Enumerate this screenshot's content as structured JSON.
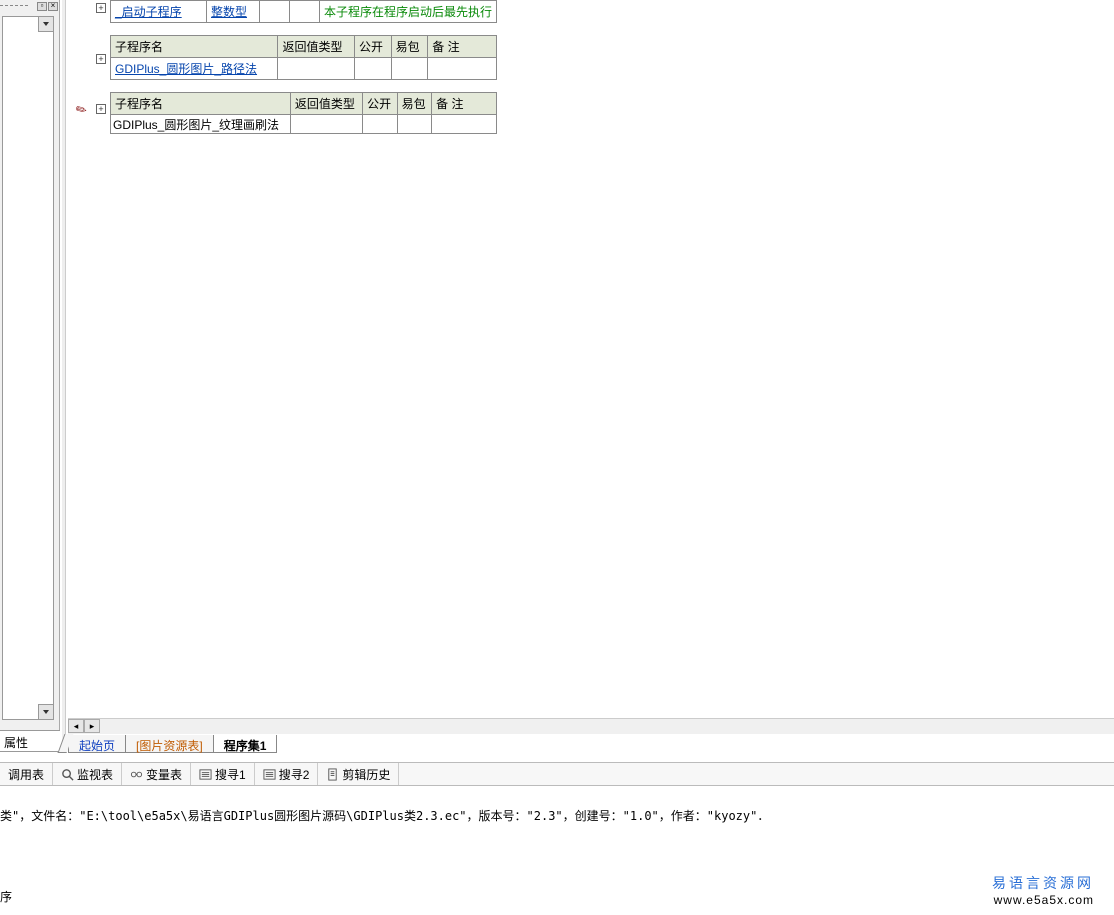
{
  "left_panel": {
    "properties_label": "属性"
  },
  "tables": {
    "row0": {
      "name": "_启动子程序",
      "ret_type": "整数型",
      "public": "",
      "pkg": "",
      "remark": "本子程序在程序启动后最先执行"
    },
    "headers": {
      "name": "子程序名",
      "ret_type": "返回值类型",
      "public": "公开",
      "pkg": "易包",
      "remark": "备 注"
    },
    "row1": {
      "name": "GDIPlus_圆形图片_路径法",
      "ret_type": "",
      "public": "",
      "pkg": "",
      "remark": ""
    },
    "row2": {
      "name": "GDIPlus_圆形图片_纹理画刷法",
      "ret_type": "",
      "public": "",
      "pkg": "",
      "remark": ""
    }
  },
  "code_tabs": {
    "start": "起始页",
    "image_res": "[图片资源表]",
    "program_set": "程序集1"
  },
  "toolbar": {
    "call_table": "调用表",
    "monitor_table": "监视表",
    "variable_table": "变量表",
    "search1": "搜寻1",
    "search2": "搜寻2",
    "clip_history": "剪辑历史"
  },
  "output": {
    "line": "类\"，文件名：\"E:\\tool\\e5a5x\\易语言GDIPlus圆形图片源码\\GDIPlus类2.3.ec\"，版本号：\"2.3\"，创建号：\"1.0\"，作者：\"kyozy\"．",
    "line2": "序"
  },
  "watermark": {
    "cn": "易语言资源网",
    "en": "www.e5a5x.com"
  }
}
